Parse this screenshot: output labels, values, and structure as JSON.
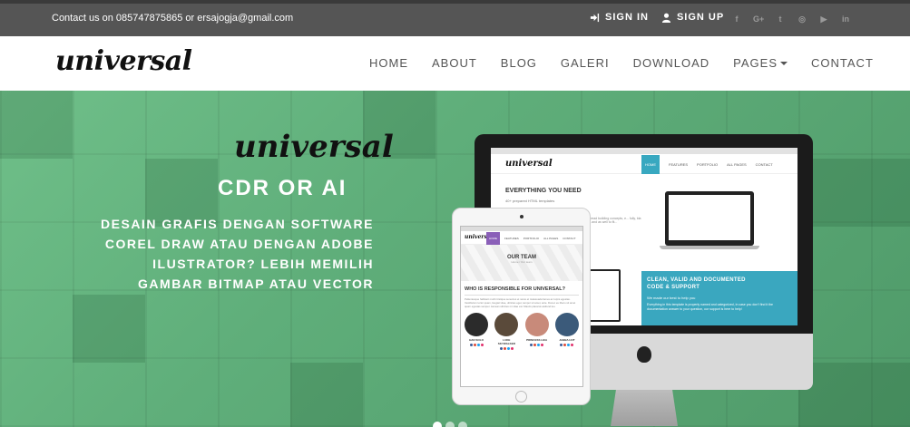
{
  "topbar": {
    "contact_text": "Contact us on 085747875865 or ersajogja@gmail.com",
    "signin_label": "SIGN IN",
    "signup_label": "SIGN UP",
    "socials": [
      {
        "name": "facebook-icon",
        "glyph": "f"
      },
      {
        "name": "google-plus-icon",
        "glyph": "G+"
      },
      {
        "name": "twitter-icon",
        "glyph": "t"
      },
      {
        "name": "instagram-icon",
        "glyph": "◎"
      },
      {
        "name": "youtube-icon",
        "glyph": "▶"
      },
      {
        "name": "linkedin-icon",
        "glyph": "in"
      }
    ]
  },
  "navbar": {
    "logo": "universal",
    "items": [
      "HOME",
      "ABOUT",
      "BLOG",
      "GALERI",
      "DOWNLOAD",
      "PAGES",
      "CONTACT"
    ]
  },
  "hero": {
    "logo": "universal",
    "title": "CDR OR AI",
    "description": "DESAIN GRAFIS DENGAN SOFTWARE COREL DRAW ATAU DENGAN ADOBE ILUSTRATOR? LEBIH MEMILIH GAMBAR BITMAP ATAU VECTOR"
  },
  "imac_screen": {
    "logo": "universal",
    "nav": [
      "HOME",
      "FEATURES",
      "PORTFOLIO",
      "ALL PAGES",
      "CONTACT"
    ],
    "heading": "EVERYTHING YOU NEED",
    "sub": "40+ prepared HTML templates",
    "lines": "...with read building concepts, e... fully, bla bla bla and as well to fit...",
    "blue_heading_1": "CLEAN, VALID AND DOCUMENTED",
    "blue_heading_2": "CODE & SUPPORT",
    "blue_sub": "We made our best to help you",
    "blue_text": "Everything in this template is properly named and categorized, in case you don't find it the documentation answer to your question, our support is here to help!"
  },
  "ipad_screen": {
    "logo": "universal",
    "nav": [
      "HOME",
      "FEATURES",
      "PORTFOLIO",
      "ALL PAGES",
      "CONTACT"
    ],
    "team_title": "OUR TEAM",
    "team_crumb": "Home / Our team",
    "who_title": "WHO IS RESPONSIBLE FOR UNIVERSAL?",
    "who_text": "Pellentesque habitant morbi tristique senectus et netus et malesuada fames ac turpis egestas. Vestibulum tortor quam, feugiat vitae, ultricies eget, tempor sit amet, ante. Donec eu libero sit amet quam egestas semper. Aenean ultricies mi vitae est. Mauris placerat eleifend leo.",
    "members": [
      {
        "name": "HAN SOLO",
        "color": "#2b2b2b"
      },
      {
        "name": "LUKE SKYWALKER",
        "color": "#5a4a3a"
      },
      {
        "name": "PRINCESS LEIA",
        "color": "#c88a7a"
      },
      {
        "name": "JABBA HUT",
        "color": "#3b5a7a"
      }
    ]
  },
  "carousel": {
    "slides": 3,
    "active": 0
  }
}
